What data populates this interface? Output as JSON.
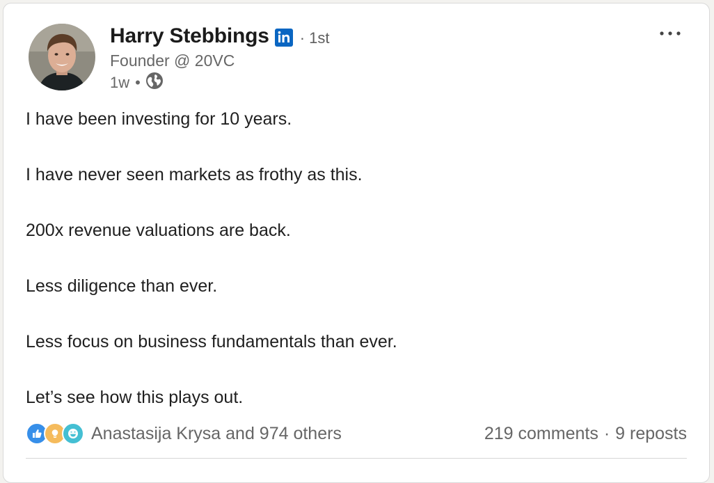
{
  "author": {
    "name": "Harry Stebbings",
    "badge_icon": "linkedin-icon",
    "degree": "· 1st",
    "headline": "Founder @ 20VC",
    "time": "1w",
    "visibility_icon": "globe-icon"
  },
  "more_icon": "more-horizontal-icon",
  "post": {
    "lines": [
      "I have been investing for 10 years.",
      "I have never seen markets as frothy as this.",
      "200x revenue valuations are back.",
      "Less diligence than ever.",
      "Less focus on business fundamentals than ever.",
      "Let’s see how this plays out."
    ]
  },
  "social": {
    "reaction_icons": [
      "like-icon",
      "insightful-icon",
      "funny-icon"
    ],
    "reactions_text": "Anastasija Krysa and 974 others",
    "comments": "219 comments",
    "separator": "·",
    "reposts": "9 reposts"
  },
  "colors": {
    "linkedin_blue": "#0a66c2",
    "like_blue": "#378fe9",
    "insightful_yellow": "#f5bb5c",
    "funny_teal": "#44bfd3"
  }
}
